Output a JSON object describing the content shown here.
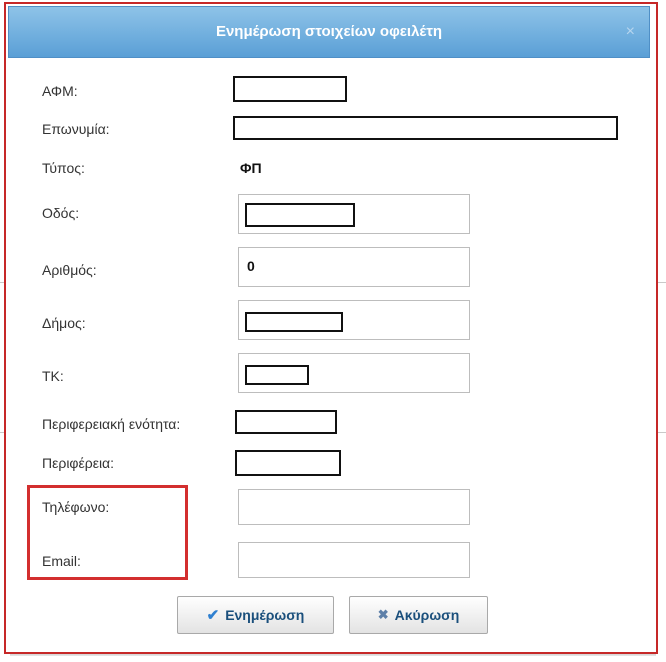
{
  "dialog": {
    "title": "Ενημέρωση στοιχείων οφειλέτη",
    "close_icon": "×"
  },
  "fields": {
    "afm_label": "ΑΦΜ:",
    "surname_label": "Επωνυμία:",
    "type_label": "Τύπος:",
    "type_value": "ΦΠ",
    "street_label": "Οδός:",
    "number_label": "Αριθμός:",
    "number_value": "0",
    "municipality_label": "Δήμος:",
    "tk_label": "ΤΚ:",
    "regional_unit_label": "Περιφερειακή ενότητα:",
    "region_label": "Περιφέρεια:",
    "phone_label": "Τηλέφωνο:",
    "email_label": "Email:"
  },
  "buttons": {
    "update_label": "Ενημέρωση",
    "cancel_label": "Ακύρωση",
    "update_icon": "check-icon",
    "cancel_icon": "x-icon"
  },
  "colors": {
    "titlebar": "#5a9fd6",
    "highlight": "#d32f2f",
    "dialog_border": "#c62828"
  }
}
